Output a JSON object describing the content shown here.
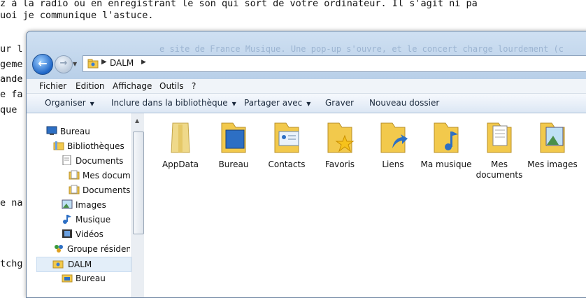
{
  "document": {
    "lines": [
      "z à la radio ou en enregistrant le son qui sort de votre ordinateur. Il s'agit ni pa",
      "uoi je communique l'astuce.",
      "",
      "ur l",
      "geme",
      "ande",
      "e fa",
      "que",
      "e na",
      "tchg"
    ],
    "faded_line": "e site de France Musique. Une pop-up s'ouvre, et le concert charge lourdement (c"
  },
  "window": {
    "address": {
      "path": [
        "DALM"
      ]
    },
    "menu": [
      "Fichier",
      "Edition",
      "Affichage",
      "Outils",
      "?"
    ],
    "toolbar": {
      "organize": "Organiser",
      "include": "Inclure dans la bibliothèque",
      "share": "Partager avec",
      "burn": "Graver",
      "new_folder": "Nouveau dossier"
    },
    "tree": [
      {
        "label": "Bureau",
        "icon": "desktop-icon"
      },
      {
        "label": "Bibliothèques",
        "icon": "library-icon"
      },
      {
        "label": "Documents",
        "icon": "documents-icon"
      },
      {
        "label": "Mes documents",
        "icon": "folder-icon"
      },
      {
        "label": "Documents p",
        "icon": "folder-icon"
      },
      {
        "label": "Images",
        "icon": "images-icon"
      },
      {
        "label": "Musique",
        "icon": "music-icon"
      },
      {
        "label": "Vidéos",
        "icon": "videos-icon"
      },
      {
        "label": "Groupe résidentie",
        "icon": "homegroup-icon"
      },
      {
        "label": "DALM",
        "icon": "user-folder-icon"
      },
      {
        "label": "Bureau",
        "icon": "desktop-folder-icon"
      }
    ],
    "files": [
      {
        "label": "AppData"
      },
      {
        "label": "Bureau"
      },
      {
        "label": "Contacts"
      },
      {
        "label": "Favoris"
      },
      {
        "label": "Liens"
      },
      {
        "label": "Ma musique"
      },
      {
        "label": "Mes documents"
      },
      {
        "label": "Mes images"
      }
    ]
  },
  "colors": {
    "folder": "#f2c94c",
    "selection": "#e3eef9",
    "accent": "#1f66c7"
  }
}
